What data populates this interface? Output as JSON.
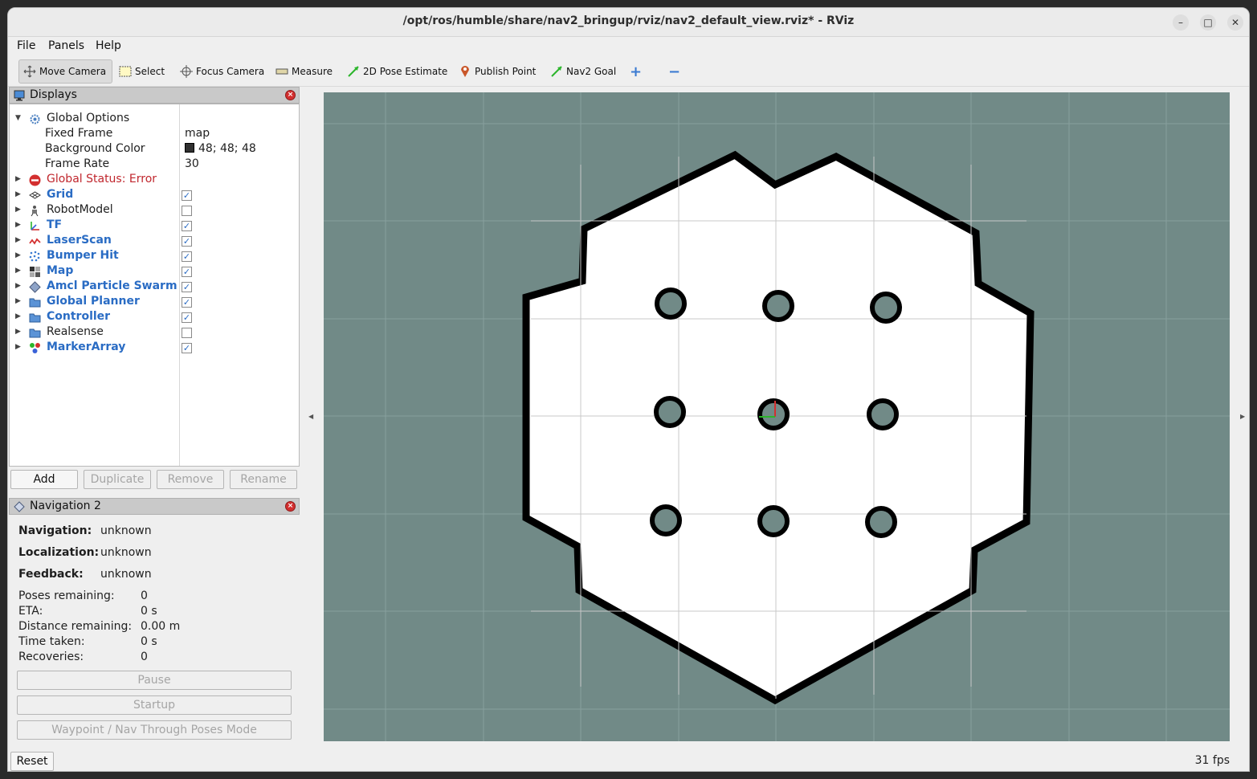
{
  "window": {
    "title": "/opt/ros/humble/share/nav2_bringup/rviz/nav2_default_view.rviz* - RViz",
    "controls": {
      "minimize": "–",
      "maximize": "□",
      "close": "✕"
    }
  },
  "menu": {
    "file": "File",
    "panels": "Panels",
    "help": "Help"
  },
  "toolbar": {
    "move_camera": "Move Camera",
    "select": "Select",
    "focus_camera": "Focus Camera",
    "measure": "Measure",
    "pose_estimate": "2D Pose Estimate",
    "publish_point": "Publish Point",
    "nav2_goal": "Nav2 Goal",
    "add_tool": "+",
    "remove_tool": "−"
  },
  "displays_panel": {
    "title": "Displays",
    "global_options": {
      "label": "Global Options",
      "fixed_frame_label": "Fixed Frame",
      "fixed_frame_value": "map",
      "bg_color_label": "Background Color",
      "bg_color_value": "48; 48; 48",
      "frame_rate_label": "Frame Rate",
      "frame_rate_value": "30"
    },
    "global_status": "Global Status: Error",
    "items": [
      {
        "label": "Grid",
        "checked": "✓"
      },
      {
        "label": "RobotModel",
        "checked": ""
      },
      {
        "label": "TF",
        "checked": "✓"
      },
      {
        "label": "LaserScan",
        "checked": "✓"
      },
      {
        "label": "Bumper Hit",
        "checked": "✓"
      },
      {
        "label": "Map",
        "checked": "✓"
      },
      {
        "label": "Amcl Particle Swarm",
        "checked": "✓"
      },
      {
        "label": "Global Planner",
        "checked": "✓"
      },
      {
        "label": "Controller",
        "checked": "✓"
      },
      {
        "label": "Realsense",
        "checked": ""
      },
      {
        "label": "MarkerArray",
        "checked": "✓"
      }
    ],
    "buttons": {
      "add": "Add",
      "duplicate": "Duplicate",
      "remove": "Remove",
      "rename": "Rename"
    }
  },
  "nav_panel": {
    "title": "Navigation 2",
    "navigation_label": "Navigation:",
    "navigation_value": "unknown",
    "localization_label": "Localization:",
    "localization_value": "unknown",
    "feedback_label": "Feedback:",
    "feedback_value": "unknown",
    "poses_label": "Poses remaining:",
    "poses_value": "0",
    "eta_label": "ETA:",
    "eta_value": "0 s",
    "distance_label": "Distance remaining:",
    "distance_value": "0.00 m",
    "time_label": "Time taken:",
    "time_value": "0 s",
    "recoveries_label": "Recoveries:",
    "recoveries_value": "0",
    "pause_button": "Pause",
    "startup_button": "Startup",
    "waypoint_button": "Waypoint / Nav Through Poses Mode"
  },
  "status": {
    "reset": "Reset",
    "fps": "31 fps"
  },
  "colors": {
    "viewport_bg": "#718a87",
    "grid_line": "#8ea3a0",
    "free_space": "#ffffff",
    "obstacle": "#000000",
    "link_blue": "#2a6cc4",
    "error_red": "#c0262d"
  }
}
